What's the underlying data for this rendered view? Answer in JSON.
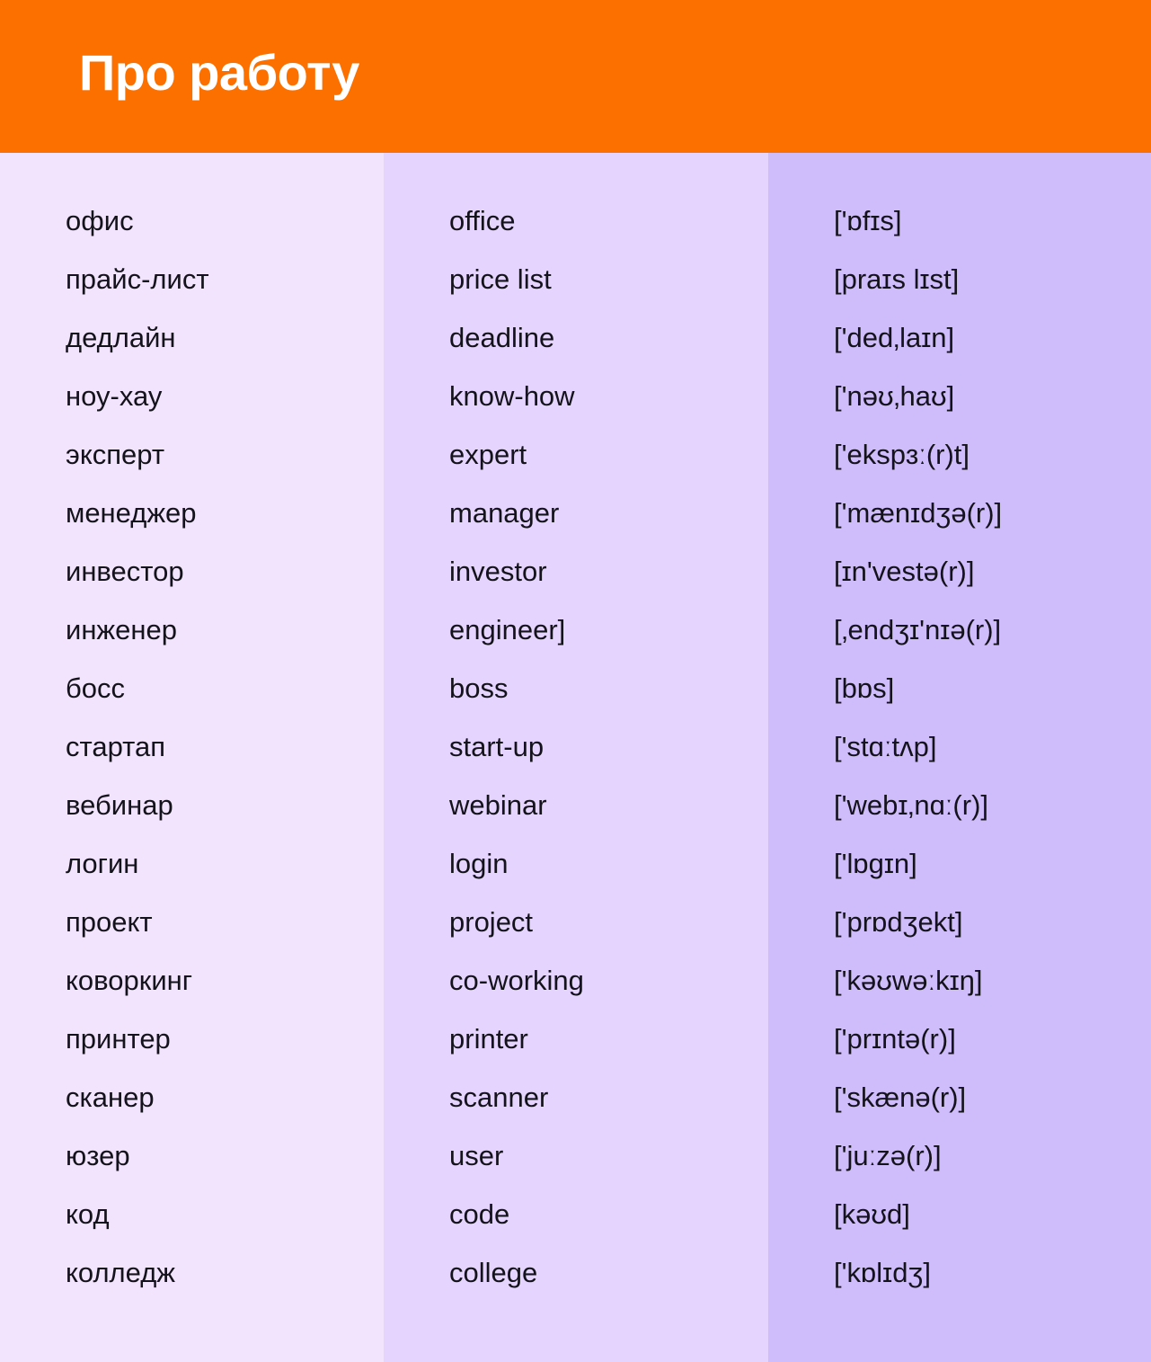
{
  "header": {
    "title": "Про работу",
    "background_color": "#fc7000",
    "text_color": "#ffffff"
  },
  "columns": {
    "russian_bg": "#f3e4fd",
    "english_bg": "#e5d4fd",
    "transcription_bg": "#cfbcfb"
  },
  "rows": [
    {
      "ru": "офис",
      "en": "office",
      "ipa": "['ɒfɪs]"
    },
    {
      "ru": "прайс-лист",
      "en": "price list",
      "ipa": "[praɪs lɪst]"
    },
    {
      "ru": "дедлайн",
      "en": "deadline",
      "ipa": "['ded‚laɪn]"
    },
    {
      "ru": "ноу-хау",
      "en": "know-how",
      "ipa": "['nəʊ‚haʊ]"
    },
    {
      "ru": "эксперт",
      "en": "expert",
      "ipa": "['ekspɜː(r)t]"
    },
    {
      "ru": "менеджер",
      "en": "manager",
      "ipa": "['mænɪdʒə(r)]"
    },
    {
      "ru": "инвестор",
      "en": "investor",
      "ipa": "[ɪn'vestə(r)]"
    },
    {
      "ru": "инженер",
      "en": "engineer]",
      "ipa": "[‚endʒɪ'nɪə(r)]"
    },
    {
      "ru": "босс",
      "en": "boss",
      "ipa": "[bɒs]"
    },
    {
      "ru": "стартап",
      "en": "start-up",
      "ipa": "['stɑːtʌp]"
    },
    {
      "ru": "вебинар",
      "en": "webinar",
      "ipa": "['webɪ‚nɑː(r)]"
    },
    {
      "ru": "логин",
      "en": "login",
      "ipa": "['lɒgɪn]"
    },
    {
      "ru": "проект",
      "en": "project",
      "ipa": "['prɒdʒekt]"
    },
    {
      "ru": "коворкинг",
      "en": "co-working",
      "ipa": "['kəʊwəːkɪŋ]"
    },
    {
      "ru": "принтер",
      "en": "printer",
      "ipa": "['prɪntə(r)]"
    },
    {
      "ru": "сканер",
      "en": "scanner",
      "ipa": "['skænə(r)]"
    },
    {
      "ru": "юзер",
      "en": "user",
      "ipa": "['juːzə(r)]"
    },
    {
      "ru": "код",
      "en": "code",
      "ipa": "[kəʊd]"
    },
    {
      "ru": "колледж",
      "en": "college",
      "ipa": "['kɒlɪdʒ]"
    }
  ]
}
